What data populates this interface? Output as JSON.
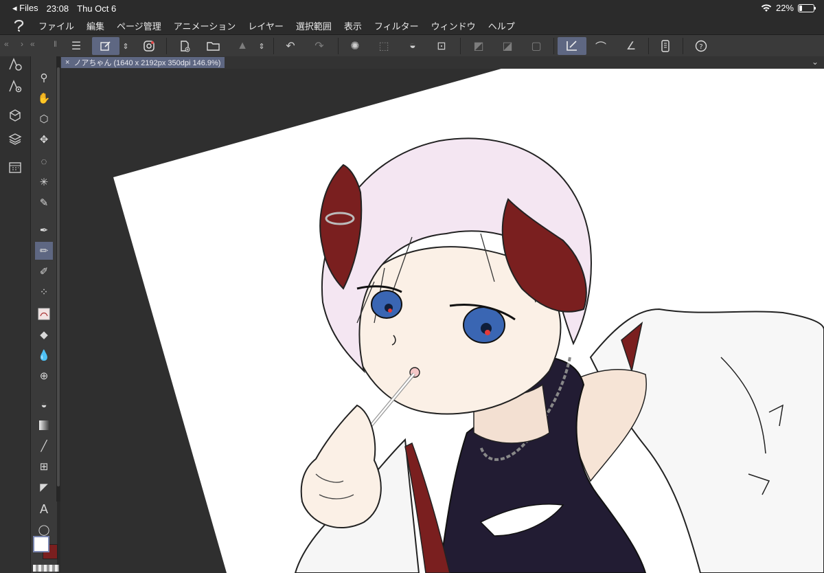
{
  "status_bar": {
    "back_label": "Files",
    "time": "23:08",
    "date": "Thu Oct 6",
    "battery": "22%",
    "battery_level": 0.22
  },
  "menu": [
    "ファイル",
    "編集",
    "ページ管理",
    "アニメーション",
    "レイヤー",
    "選択範囲",
    "表示",
    "フィルター",
    "ウィンドウ",
    "ヘルプ"
  ],
  "document_tab": {
    "title": "ノアちゃん (1640 x 2192px 350dpi 146.9%)"
  },
  "left_panel_icons": [
    "tool-property-icon",
    "sub-tool-detail-icon",
    "material-icon",
    "layer-icon",
    "calendar-icon"
  ],
  "toolbar_icons": [
    "menu-icon",
    "quick-access-icon",
    "companion-mode-icon",
    "new-file-icon",
    "open-file-icon",
    "save-icon",
    "undo-icon",
    "redo-icon",
    "loading-icon",
    "selection-icon",
    "fill-icon",
    "transform-icon",
    "snap-icon",
    "ruler-icon",
    "frame-icon",
    "sub-tool-icon",
    "brush-size-icon",
    "stabilization-icon",
    "phone-icon",
    "help-icon"
  ],
  "tools": [
    "zoom",
    "hand",
    "object",
    "move",
    "lasso",
    "magic-wand",
    "eyedropper",
    "pen",
    "pencil",
    "brush",
    "airbrush",
    "decoration",
    "eraser",
    "blend",
    "grid",
    "fill",
    "gradient",
    "line",
    "frame",
    "ruler",
    "text",
    "balloon"
  ],
  "colors": {
    "main": "#ffffff",
    "sub": "#7a1f1f",
    "accent": "#5e6782"
  }
}
